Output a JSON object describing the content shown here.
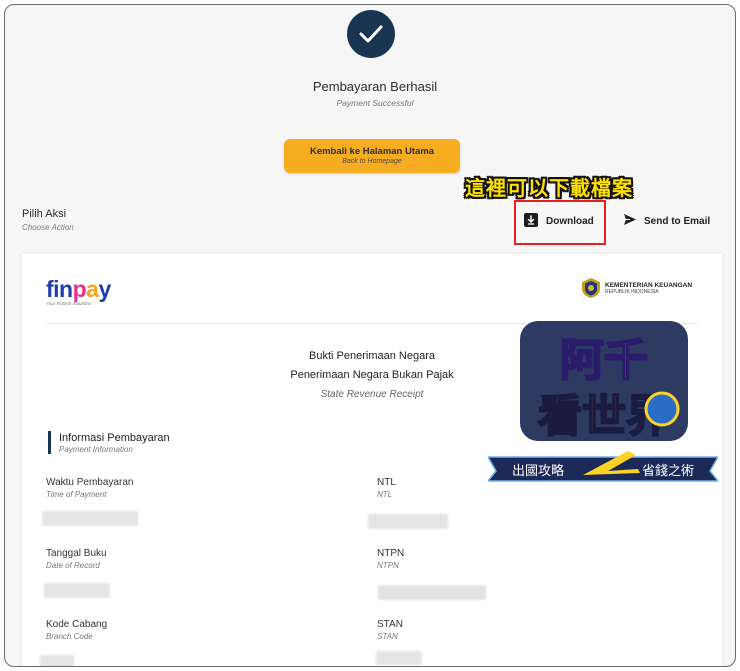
{
  "status": {
    "title": "Pembayaran Berhasil",
    "subtitle": "Payment Successful",
    "icon": "check-icon"
  },
  "home_button": {
    "label": "Kembali ke Halaman Utama",
    "sublabel": "Back to Homepage",
    "color": "#f7ad21"
  },
  "annotation": {
    "text": "這裡可以下載檔案",
    "highlight_color": "#e81f1f"
  },
  "actions": {
    "title": "Pilih Aksi",
    "subtitle": "Choose Action",
    "download_label": "Download",
    "email_label": "Send to Email"
  },
  "receipt": {
    "logo_brand_parts": [
      "fin",
      "p",
      "a",
      "y"
    ],
    "logo_tagline": "Your Fintech Solutions",
    "ministry_name": "KEMENTERIAN KEUANGAN",
    "ministry_sub": "REPUBLIK INDONESIA",
    "title_line1": "Bukti Penerimaan Negara",
    "title_line2": "Penerimaan Negara Bukan Pajak",
    "title_en": "State Revenue Receipt",
    "section_title": "Informasi Pembayaran",
    "section_subtitle": "Payment Information",
    "fields": [
      {
        "label": "Waktu Pembayaran",
        "sub": "Time of Payment"
      },
      {
        "label": "NTL",
        "sub": "NTL"
      },
      {
        "label": "Tanggal Buku",
        "sub": "Date of Record"
      },
      {
        "label": "NTPN",
        "sub": "NTPN"
      },
      {
        "label": "Kode Cabang",
        "sub": "Branch Code"
      },
      {
        "label": "STAN",
        "sub": "STAN"
      }
    ]
  },
  "watermark": {
    "line1": "阿千",
    "line2": "看世界",
    "left_banner": "出國攻略",
    "right_banner": "省錢之術"
  },
  "colors": {
    "accent_navy": "#1a3552",
    "accent_orange": "#f7ad21",
    "page_bg": "#f6f6f7"
  }
}
